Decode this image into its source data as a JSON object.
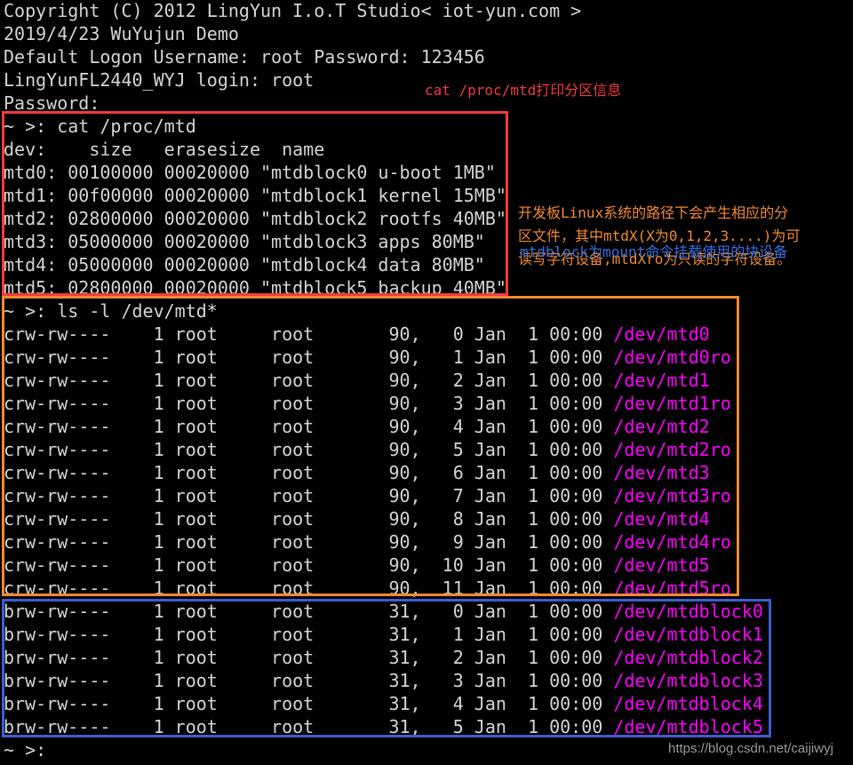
{
  "header_lines": [
    "Copyright (C) 2012 LingYun I.o.T Studio< iot-yun.com >",
    "2019/4/23 WuYujun Demo",
    "Default Logon Username: root Password: 123456",
    "LingYunFL2440_WYJ login: root",
    "Password:"
  ],
  "mtd_section": {
    "command": "~ >: cat /proc/mtd",
    "columns": "dev:    size   erasesize  name",
    "rows": [
      "mtd0: 00100000 00020000 \"mtdblock0 u-boot 1MB\"",
      "mtd1: 00f00000 00020000 \"mtdblock1 kernel 15MB\"",
      "mtd2: 02800000 00020000 \"mtdblock2 rootfs 40MB\"",
      "mtd3: 05000000 00020000 \"mtdblock3 apps 80MB\"",
      "mtd4: 05000000 00020000 \"mtdblock4 data 80MB\"",
      "mtd5: 02800000 00020000 \"mtdblock5 backup 40MB\""
    ]
  },
  "ls_section": {
    "command": "~ >: ls -l /dev/mtd*",
    "char_rows": [
      {
        "info": "crw-rw----    1 root     root       90,   0 Jan  1 00:00 ",
        "path": "/dev/mtd0"
      },
      {
        "info": "crw-rw----    1 root     root       90,   1 Jan  1 00:00 ",
        "path": "/dev/mtd0ro"
      },
      {
        "info": "crw-rw----    1 root     root       90,   2 Jan  1 00:00 ",
        "path": "/dev/mtd1"
      },
      {
        "info": "crw-rw----    1 root     root       90,   3 Jan  1 00:00 ",
        "path": "/dev/mtd1ro"
      },
      {
        "info": "crw-rw----    1 root     root       90,   4 Jan  1 00:00 ",
        "path": "/dev/mtd2"
      },
      {
        "info": "crw-rw----    1 root     root       90,   5 Jan  1 00:00 ",
        "path": "/dev/mtd2ro"
      },
      {
        "info": "crw-rw----    1 root     root       90,   6 Jan  1 00:00 ",
        "path": "/dev/mtd3"
      },
      {
        "info": "crw-rw----    1 root     root       90,   7 Jan  1 00:00 ",
        "path": "/dev/mtd3ro"
      },
      {
        "info": "crw-rw----    1 root     root       90,   8 Jan  1 00:00 ",
        "path": "/dev/mtd4"
      },
      {
        "info": "crw-rw----    1 root     root       90,   9 Jan  1 00:00 ",
        "path": "/dev/mtd4ro"
      },
      {
        "info": "crw-rw----    1 root     root       90,  10 Jan  1 00:00 ",
        "path": "/dev/mtd5"
      },
      {
        "info": "crw-rw----    1 root     root       90,  11 Jan  1 00:00 ",
        "path": "/dev/mtd5ro"
      }
    ],
    "block_rows": [
      {
        "info": "brw-rw----    1 root     root       31,   0 Jan  1 00:00 ",
        "path": "/dev/mtdblock0"
      },
      {
        "info": "brw-rw----    1 root     root       31,   1 Jan  1 00:00 ",
        "path": "/dev/mtdblock1"
      },
      {
        "info": "brw-rw----    1 root     root       31,   2 Jan  1 00:00 ",
        "path": "/dev/mtdblock2"
      },
      {
        "info": "brw-rw----    1 root     root       31,   3 Jan  1 00:00 ",
        "path": "/dev/mtdblock3"
      },
      {
        "info": "brw-rw----    1 root     root       31,   4 Jan  1 00:00 ",
        "path": "/dev/mtdblock4"
      },
      {
        "info": "brw-rw----    1 root     root       31,   5 Jan  1 00:00 ",
        "path": "/dev/mtdblock5"
      }
    ]
  },
  "final_prompt": "~ >:",
  "annotations": {
    "red": "cat /proc/mtd打印分区信息",
    "orange": [
      "开发板Linux系统的路径下会产生相应的分",
      "区文件，其中mtdX(X为0,1,2,3....)为可",
      "读写字符设备,mtdXro为只读的字符设备。"
    ],
    "blue": "mtdblock为mount命令挂载使用的块设备"
  },
  "watermark": "https://blog.csdn.net/caijiwyj",
  "colors": {
    "text": "#d4d4d4",
    "path": "#ff00ff",
    "red": "#f03c3c",
    "orange": "#f08a30",
    "blue": "#3a5fd0"
  }
}
